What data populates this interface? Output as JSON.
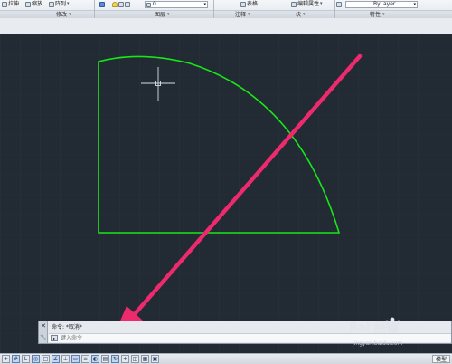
{
  "ribbon": {
    "top_items": {
      "stretch": "拉伸",
      "scale": "缩放",
      "array": "阵列",
      "layer_value": "0",
      "table": "表格",
      "edit_attribute": "编辑属性",
      "bylayer": "ByLayer"
    },
    "panels": {
      "modify": "修改",
      "layers": "图层",
      "annotation": "注释",
      "block": "块",
      "properties": "特性"
    }
  },
  "command": {
    "history": "命令: *取消*",
    "placeholder": "键入命令"
  },
  "status": {
    "model_tab": "模型"
  },
  "drawing": {
    "colors": {
      "background": "#222a33",
      "grid": "#2c3540",
      "shape": "#19e619",
      "cursor": "#d8dde4",
      "arrow": "#ee2a6e"
    }
  },
  "watermark": {
    "brand": "Bai 经验",
    "caption": "jingyan.baidu.com"
  }
}
